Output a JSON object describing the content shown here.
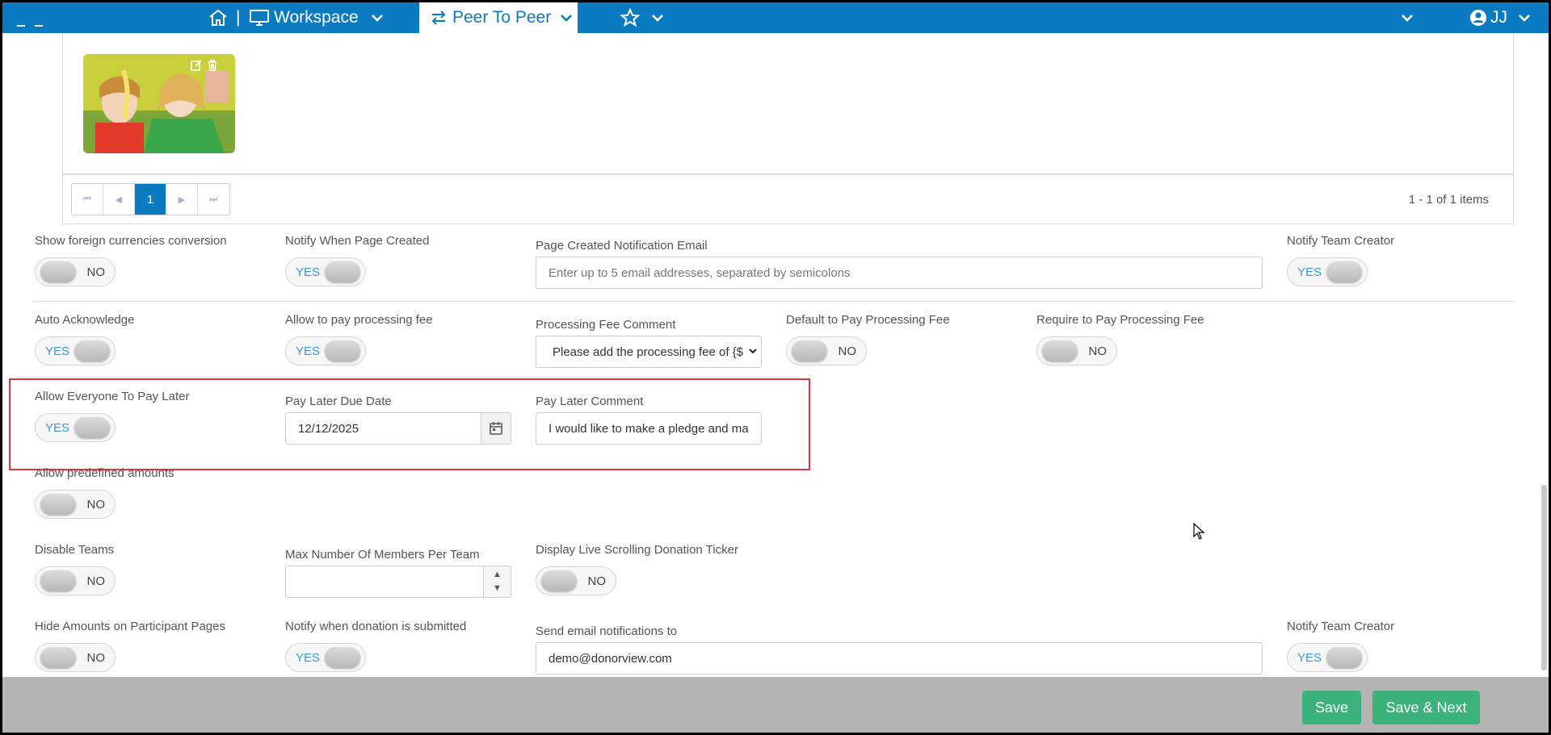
{
  "nav": {
    "workspace_label": "Workspace",
    "separator": "|",
    "active_tab_label": "Peer To Peer",
    "user_initials": "JJ"
  },
  "gallery": {
    "pager_current": "1",
    "pager_info": "1 - 1 of 1 items"
  },
  "settings": {
    "row1": {
      "foreign_label": "Show foreign currencies conversion",
      "foreign_value": "NO",
      "notify_page_label": "Notify When Page Created",
      "notify_page_value": "YES",
      "page_email_label": "Page Created Notification Email",
      "page_email_placeholder": "Enter up to 5 email addresses, separated by semicolons",
      "notify_team_label": "Notify Team Creator",
      "notify_team_value": "YES"
    },
    "row2": {
      "auto_ack_label": "Auto Acknowledge",
      "auto_ack_value": "YES",
      "allow_fee_label": "Allow to pay processing fee",
      "allow_fee_value": "YES",
      "fee_comment_label": "Processing Fee Comment",
      "fee_comment_value": "Please add the processing fee of {$",
      "default_fee_label": "Default to Pay Processing Fee",
      "default_fee_value": "NO",
      "require_fee_label": "Require to Pay Processing Fee",
      "require_fee_value": "NO"
    },
    "row3": {
      "pay_later_label": "Allow Everyone To Pay Later",
      "pay_later_value": "YES",
      "due_date_label": "Pay Later Due Date",
      "due_date_value": "12/12/2025",
      "pay_later_comment_label": "Pay Later Comment",
      "pay_later_comment_value": "I would like to make a pledge and ma"
    },
    "row4": {
      "predefined_label": "Allow predefined amounts",
      "predefined_value": "NO"
    },
    "row5": {
      "disable_teams_label": "Disable Teams",
      "disable_teams_value": "NO",
      "max_members_label": "Max Number Of Members Per Team",
      "max_members_value": "",
      "ticker_label": "Display Live Scrolling Donation Ticker",
      "ticker_value": "NO"
    },
    "row6": {
      "hide_amounts_label": "Hide Amounts on Participant Pages",
      "hide_amounts_value": "NO",
      "notify_donation_label": "Notify when donation is submitted",
      "notify_donation_value": "YES",
      "send_email_label": "Send email notifications to",
      "send_email_value": "demo@donorview.com",
      "notify_team2_label": "Notify Team Creator",
      "notify_team2_value": "YES"
    }
  },
  "footer": {
    "save_label": "Save",
    "save_next_label": "Save & Next"
  },
  "colors": {
    "nav_blue": "#0a7bc1",
    "save_green": "#3ab27a",
    "highlight_red": "#e0353f",
    "toggle_yes_text": "#3a9ad9"
  }
}
